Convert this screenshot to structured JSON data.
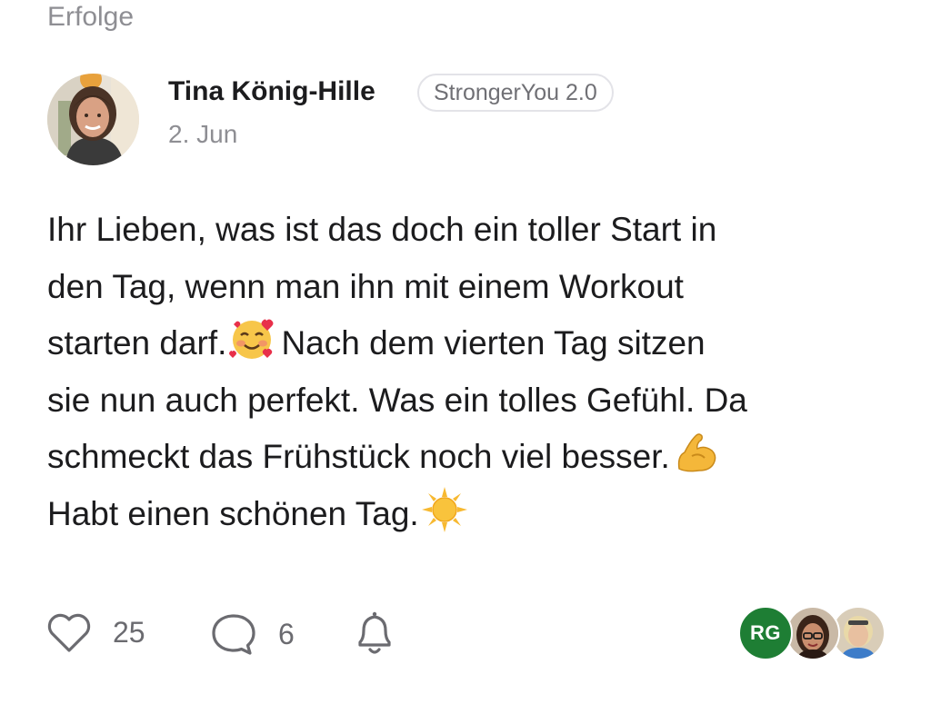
{
  "section": {
    "title": "Erfolge"
  },
  "post": {
    "author": "Tina König-Hille",
    "group": "StrongerYou 2.0",
    "date": "2. Jun",
    "body_lines": [
      "Ihr Lieben, was ist das doch ein toller Start in",
      "den Tag, wenn man ihn mit einem Workout",
      "starten darf.",
      "Nach dem vierten Tag sitzen",
      "sie nun auch perfekt. Was ein tolles Gefühl. Da",
      "schmeckt das Frühstück noch viel besser.",
      "Habt einen schönen Tag."
    ],
    "emojis": [
      "smiling-face-with-hearts",
      "flexed-biceps",
      "sun"
    ]
  },
  "actions": {
    "likes": "25",
    "comments": "6",
    "icons": [
      "heart-icon",
      "comment-icon",
      "bell-icon"
    ]
  },
  "participants": {
    "initials": "RG",
    "initials_color": "#1e7e34"
  }
}
